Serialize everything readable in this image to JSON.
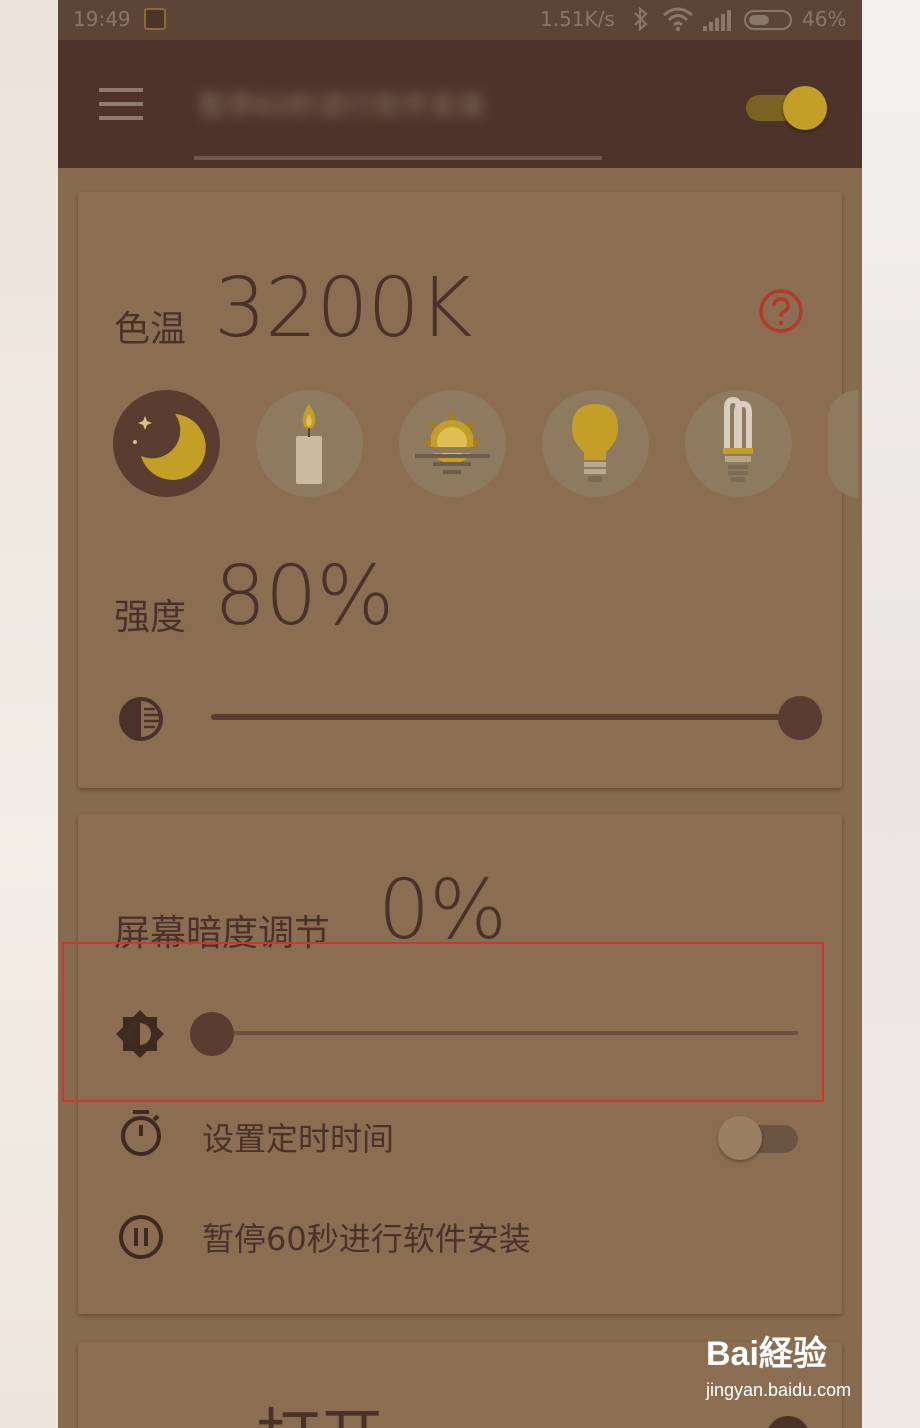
{
  "status_bar": {
    "time": "19:49",
    "net_speed": "1.51K/s",
    "battery": "46%"
  },
  "app_bar": {
    "title": "暂停60秒进行软件安装",
    "master_toggle_on": true
  },
  "color_temp": {
    "label": "色温",
    "value": "3200K",
    "presets": [
      "moon-icon",
      "candle-icon",
      "sunset-icon",
      "bulb-icon",
      "cfl-bulb-icon"
    ],
    "selected_preset": 0,
    "colors": {
      "accent": "#c39f27",
      "text": "#4a3229",
      "help": "#b23a2c"
    }
  },
  "intensity": {
    "label": "强度",
    "value": "80%",
    "slider_level": 1.0
  },
  "dim": {
    "label": "屏幕暗度调节",
    "value": "0%",
    "slider_level": 0.0
  },
  "options": {
    "timer_label": "设置定时时间",
    "timer_on": false,
    "pause_label": "暂停60秒进行软件安装"
  },
  "bottom": {
    "label": "打开"
  },
  "watermark": {
    "brand": "Bai経验",
    "url": "jingyan.baidu.com"
  }
}
